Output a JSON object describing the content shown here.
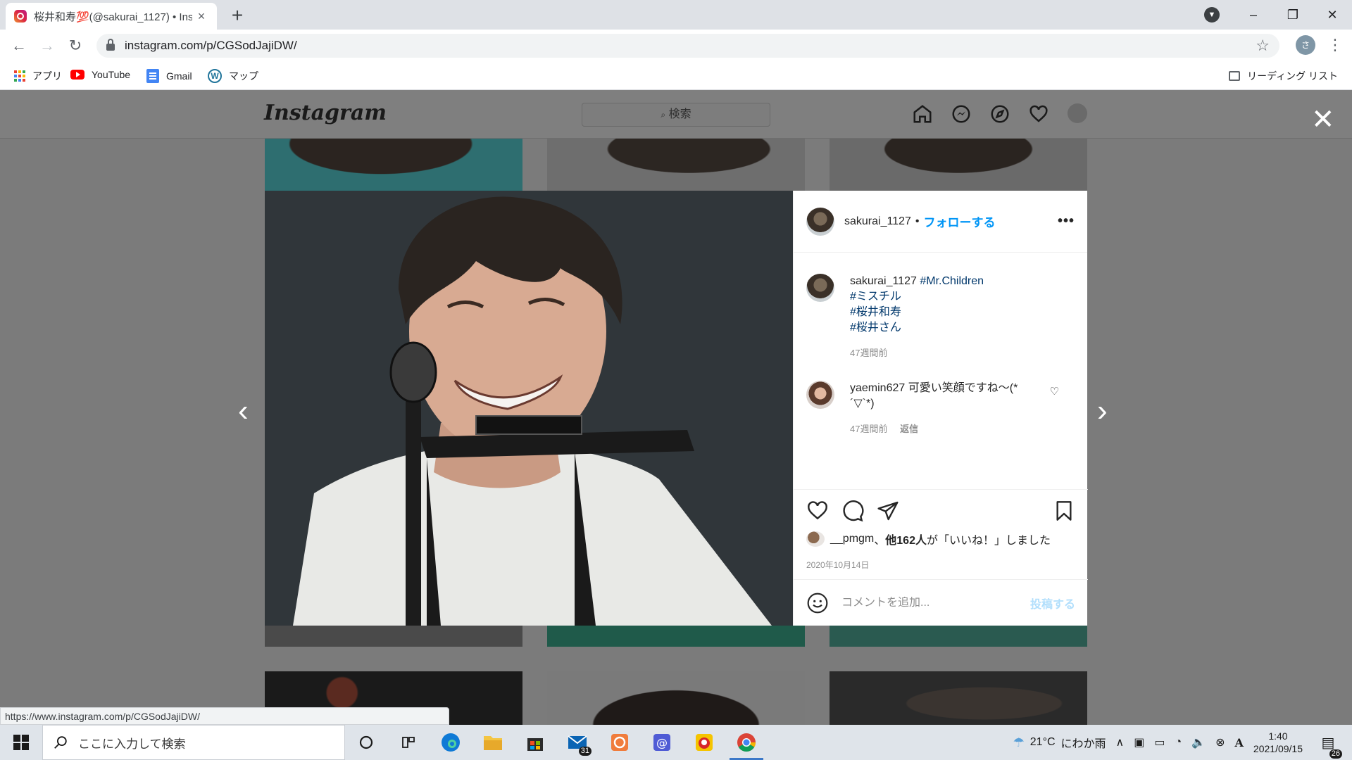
{
  "browser": {
    "tab_title": "桜井和寿💯(@sakurai_1127) • Ins",
    "tab_close": "×",
    "new_tab": "+",
    "url": "instagram.com/p/CGSodJajiDW/",
    "profile_initial": "さ",
    "minimize": "–",
    "maximize": "❐",
    "close": "✕",
    "bookmarks": [
      {
        "label": "アプリ",
        "icon": "apps-grid-icon"
      },
      {
        "label": "YouTube",
        "icon": "youtube-icon"
      },
      {
        "label": "Gmail",
        "icon": "gmail-icon"
      },
      {
        "label": "マップ",
        "icon": "wordpress-icon"
      }
    ],
    "reading_list": "リーディング リスト",
    "status_url": "https://www.instagram.com/p/CGSodJajiDW/"
  },
  "instagram": {
    "logo": "Instagram",
    "search_placeholder": "検索",
    "search_icon": "🔍"
  },
  "post": {
    "username": "sakurai_1127",
    "separator": "•",
    "follow_label": "フォローする",
    "more_label": "•••",
    "caption_hashtags_inline": "#Mr.Children",
    "caption_hashtags": [
      "#ミスチル",
      "#桜井和寿",
      "#桜井さん"
    ],
    "caption_time": "47週間前",
    "comment": {
      "username": "yaemin627",
      "text": "可愛い笑顔ですね〜(*´▽`*)",
      "time": "47週間前",
      "reply": "返信"
    },
    "likes_user": "__pmgm",
    "likes_mid": "、",
    "likes_count": "他162人",
    "likes_suffix": "が「いいね！」しました",
    "date": "2020年10月14日",
    "comment_placeholder": "コメントを追加...",
    "post_button": "投稿する"
  },
  "taskbar": {
    "search_placeholder": "ここに入力して検索",
    "weather_temp": "21°C",
    "weather_text": "にわか雨",
    "time": "1:40",
    "date": "2021/09/15",
    "mail_badge": "31",
    "notif_badge": "26",
    "ime": "A"
  },
  "colors": {
    "accent_blue": "#0095f6",
    "hashtag_blue": "#00376b",
    "dim_overlay": "#7b7b7b"
  }
}
